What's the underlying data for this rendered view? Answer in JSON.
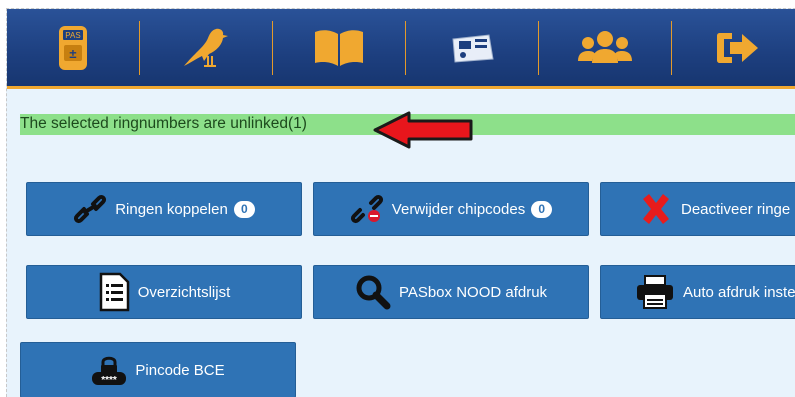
{
  "nav": {
    "items": [
      {
        "name": "pas-device",
        "icon": "pas-device-icon",
        "label": "PAS"
      },
      {
        "name": "pigeon",
        "icon": "pigeon-icon"
      },
      {
        "name": "book",
        "icon": "book-icon"
      },
      {
        "name": "scanner",
        "icon": "scanner-icon"
      },
      {
        "name": "users",
        "icon": "users-icon"
      },
      {
        "name": "logout",
        "icon": "logout-icon"
      }
    ],
    "colors": {
      "background": "#1d3f7f",
      "accent": "#f0a830"
    }
  },
  "status": {
    "message": "The selected ringnumbers are unlinked(1)",
    "color": "#8de08a"
  },
  "buttons": {
    "ringen_koppelen": {
      "label": "Ringen koppelen",
      "badge": "0",
      "icon": "link-icon"
    },
    "verwijder_chipcodes": {
      "label": "Verwijder chipcodes",
      "badge": "0",
      "icon": "unlink-icon"
    },
    "deactiveer_ringen": {
      "label": "Deactiveer ringe",
      "icon": "red-x-icon"
    },
    "overzichtslijst": {
      "label": "Overzichtslijst",
      "icon": "list-document-icon"
    },
    "pasbox_nood_afdruk": {
      "label": "PASbox NOOD afdruk",
      "icon": "search-icon"
    },
    "auto_afdruk": {
      "label": "Auto afdruk inste",
      "icon": "printer-icon"
    },
    "pincode_bce": {
      "label": "Pincode BCE",
      "icon": "lock-pin-icon",
      "pin_mask": "****"
    }
  }
}
